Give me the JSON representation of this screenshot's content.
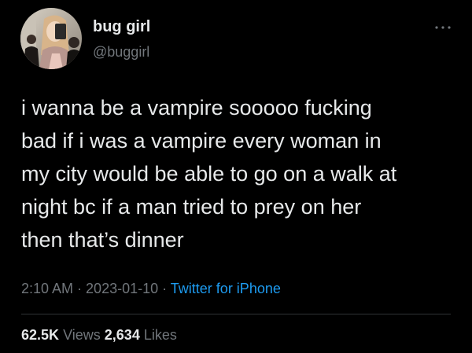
{
  "user": {
    "display_name": "bug girl",
    "handle": "@buggirl",
    "avatar_icon": "avatar-photo"
  },
  "tweet": {
    "text": "i wanna be a vampire sooooo fucking\nbad if i was a vampire every woman in\nmy city would be able to go on a walk at\nnight bc if a man tried to prey on her\nthen that’s dinner",
    "time": "2:10 AM",
    "date": "2023-01-10",
    "separator": " · ",
    "source": "Twitter for iPhone"
  },
  "stats": {
    "views_count": "62.5K",
    "views_label": "Views",
    "likes_count": "2,634",
    "likes_label": "Likes"
  },
  "colors": {
    "background": "#000000",
    "text_primary": "#e7e9ea",
    "text_secondary": "#71767b",
    "accent": "#1d9bf0",
    "divider": "#2f3336"
  },
  "icons": {
    "more": "more-horizontal-icon"
  }
}
